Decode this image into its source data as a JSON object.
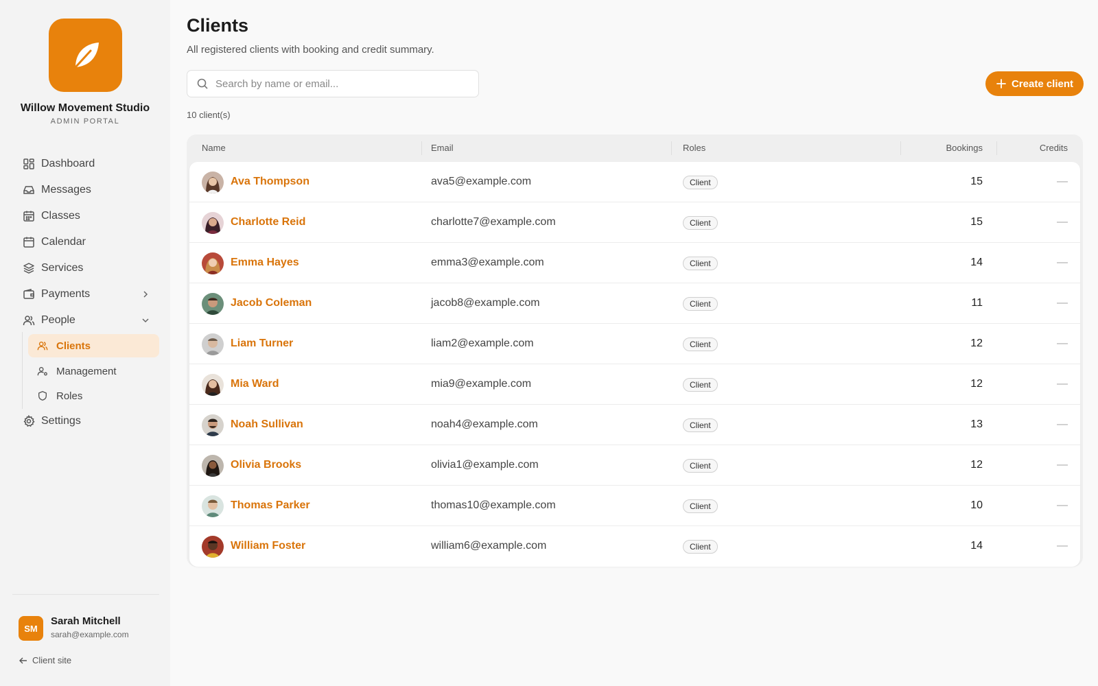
{
  "sidebar": {
    "studio_name": "Willow Movement Studio",
    "portal_label": "ADMIN PORTAL",
    "items": [
      {
        "label": "Dashboard",
        "icon": "dashboard-icon"
      },
      {
        "label": "Messages",
        "icon": "inbox-icon"
      },
      {
        "label": "Classes",
        "icon": "calendar-grid-icon"
      },
      {
        "label": "Calendar",
        "icon": "calendar-icon"
      },
      {
        "label": "Services",
        "icon": "layers-icon"
      },
      {
        "label": "Payments",
        "icon": "wallet-icon"
      },
      {
        "label": "People",
        "icon": "users-icon"
      },
      {
        "label": "Settings",
        "icon": "gear-icon"
      }
    ],
    "people_sub": [
      {
        "label": "Clients",
        "icon": "users-icon",
        "active": true
      },
      {
        "label": "Management",
        "icon": "user-cog-icon"
      },
      {
        "label": "Roles",
        "icon": "shield-icon"
      }
    ],
    "user": {
      "initials": "SM",
      "name": "Sarah Mitchell",
      "email": "sarah@example.com"
    },
    "client_site": "Client site"
  },
  "main": {
    "title": "Clients",
    "subtitle": "All registered clients with booking and credit summary.",
    "search_placeholder": "Search by name or email...",
    "create_label": "Create client",
    "count_label": "10 client(s)",
    "columns": [
      "Name",
      "Email",
      "Roles",
      "Bookings",
      "Credits"
    ],
    "rows": [
      {
        "name": "Ava Thompson",
        "email": "ava5@example.com",
        "role": "Client",
        "bookings": "15",
        "credits": "—"
      },
      {
        "name": "Charlotte Reid",
        "email": "charlotte7@example.com",
        "role": "Client",
        "bookings": "15",
        "credits": "—"
      },
      {
        "name": "Emma Hayes",
        "email": "emma3@example.com",
        "role": "Client",
        "bookings": "14",
        "credits": "—"
      },
      {
        "name": "Jacob Coleman",
        "email": "jacob8@example.com",
        "role": "Client",
        "bookings": "11",
        "credits": "—"
      },
      {
        "name": "Liam Turner",
        "email": "liam2@example.com",
        "role": "Client",
        "bookings": "12",
        "credits": "—"
      },
      {
        "name": "Mia Ward",
        "email": "mia9@example.com",
        "role": "Client",
        "bookings": "12",
        "credits": "—"
      },
      {
        "name": "Noah Sullivan",
        "email": "noah4@example.com",
        "role": "Client",
        "bookings": "13",
        "credits": "—"
      },
      {
        "name": "Olivia Brooks",
        "email": "olivia1@example.com",
        "role": "Client",
        "bookings": "12",
        "credits": "—"
      },
      {
        "name": "Thomas Parker",
        "email": "thomas10@example.com",
        "role": "Client",
        "bookings": "10",
        "credits": "—"
      },
      {
        "name": "William Foster",
        "email": "william6@example.com",
        "role": "Client",
        "bookings": "14",
        "credits": "—"
      }
    ]
  },
  "colors": {
    "accent": "#e8820c",
    "accent_text": "#d9740a",
    "active_bg": "#fbe9d6"
  }
}
